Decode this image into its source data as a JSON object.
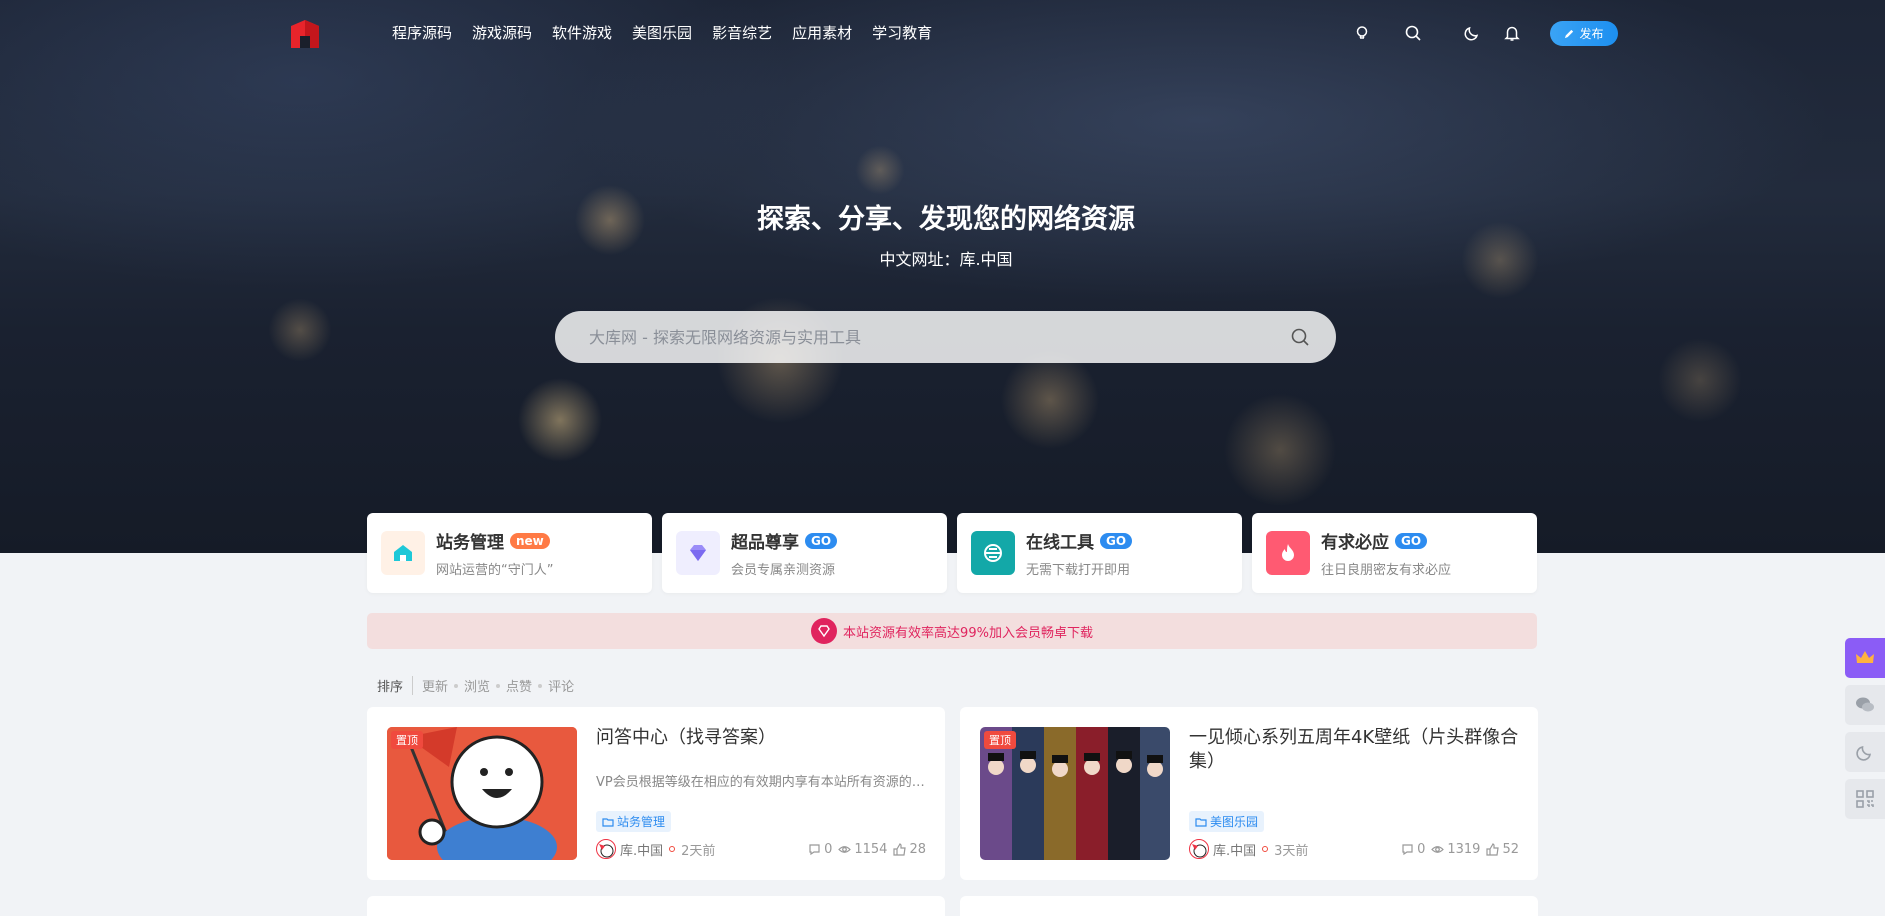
{
  "nav": {
    "items": [
      "程序源码",
      "游戏源码",
      "软件游戏",
      "美图乐园",
      "影音综艺",
      "应用素材",
      "学习教育"
    ],
    "publish_label": "发布"
  },
  "hero": {
    "title": "探索、分享、发现您的网络资源",
    "subtitle": "中文网址：库.中国",
    "search_placeholder": "大库网 - 探索无限网络资源与实用工具"
  },
  "cards": [
    {
      "title": "站务管理",
      "badge": "new",
      "desc": "网站运营的“守门人”",
      "icon": "house-icon",
      "color": "#1ec8d8"
    },
    {
      "title": "超品尊享",
      "badge": "GO",
      "desc": "会员专属亲测资源",
      "icon": "diamond-icon",
      "color": "#8b7cf6"
    },
    {
      "title": "在线工具",
      "badge": "GO",
      "desc": "无需下载打开即用",
      "icon": "tool-icon",
      "color": "#13a8a8"
    },
    {
      "title": "有求必应",
      "badge": "GO",
      "desc": "往日良朋密友有求必应",
      "icon": "fire-icon",
      "color": "#ff5a72"
    }
  ],
  "notice": {
    "text": "本站资源有效率高达99%加入会员畅卓下载"
  },
  "sort": {
    "label": "排序",
    "options": [
      "更新",
      "浏览",
      "点赞",
      "评论"
    ]
  },
  "posts": [
    {
      "pin": "置顶",
      "title": "问答中心（找寻答案）",
      "excerpt": "VP会员根据等级在相应的有效期内享有本站所有资源的下载权限",
      "category": "站务管理",
      "author": "库.中国",
      "time": "2天前",
      "comments": "0",
      "views": "1154",
      "likes": "28"
    },
    {
      "pin": "置顶",
      "title": "一见倾心系列五周年4K壁纸（片头群像合集）",
      "excerpt": "",
      "category": "美图乐园",
      "author": "库.中国",
      "time": "3天前",
      "comments": "0",
      "views": "1319",
      "likes": "52"
    }
  ],
  "colors": {
    "accent": "#2d8cf0",
    "pin": "#f04a3e",
    "notice": "#e0245e",
    "vip": "#8b5cf6"
  }
}
